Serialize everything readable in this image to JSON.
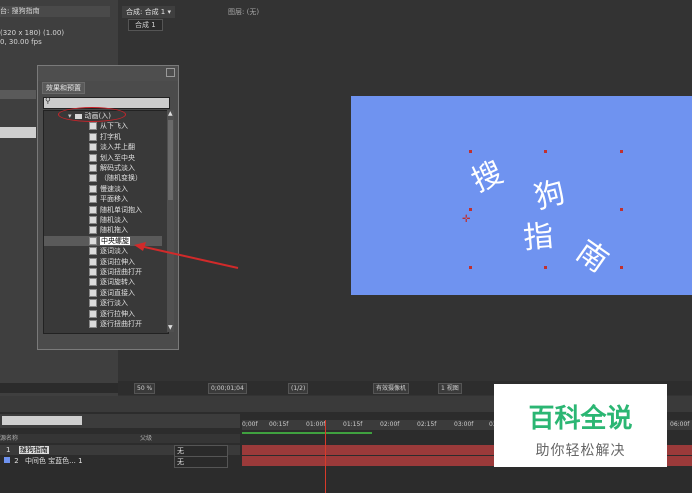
{
  "project_panel": {
    "tab_label": "台: 搜狗指南",
    "comp_size": "(320 x 180) (1.00)",
    "frame_rate": "0, 30.00 fps"
  },
  "comp_panel": {
    "tab_label": "合成: 合成 1 ▾",
    "layer_tab": "图层: (无)",
    "subtab": "合成 1",
    "canvas_chars": [
      "搜",
      "狗",
      "指",
      "南"
    ],
    "canvas_color": "#6f93f0"
  },
  "comp_toolbar": {
    "zoom": "50 %",
    "timecode": "0;00;01;04",
    "resolution": "(1/2)",
    "camera": "有效摄像机",
    "view": "1 视图"
  },
  "effects_panel": {
    "title": "效果和预置",
    "folder": "动画(入)",
    "items": [
      "从下飞入",
      "打字机",
      "淡入并上翻",
      "划入至中央",
      "解码式淡入",
      "（随机变换）",
      "慢速淡入",
      "平面移入",
      "随机单词抱入",
      "随机淡入",
      "随机拖入",
      "中央螺旋",
      "逐词淡入",
      "逐词拉伸入",
      "逐词扭曲打开",
      "逐词旋转入",
      "逐词直接入",
      "逐行淡入",
      "逐行拉伸入",
      "逐行扭曲打开"
    ],
    "selected_index": 11,
    "accent": "#c8242a"
  },
  "timeline": {
    "header_source": "源名称",
    "header_parent": "父级",
    "ruler_ticks": [
      "0;00f",
      "00:15f",
      "01:00f",
      "01:15f",
      "02:00f",
      "02:15f",
      "03:00f",
      "03",
      "06:00f"
    ],
    "layers": [
      {
        "num": "1",
        "name": "搜狗指南",
        "parent": "无"
      },
      {
        "num": "2",
        "name": "中间色 宝蓝色... 1",
        "parent": "无"
      }
    ],
    "track_color": "#9b3a3a"
  },
  "watermark": {
    "title": "百科全说",
    "subtitle": "助你轻松解决"
  }
}
